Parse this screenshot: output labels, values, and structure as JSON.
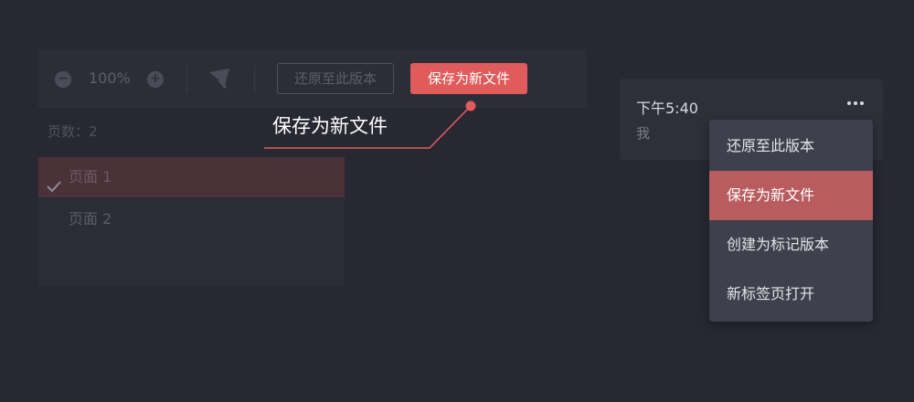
{
  "toolbar": {
    "zoom_out_icon": "minus-circle-icon",
    "zoom_level": "100%",
    "zoom_in_icon": "plus-circle-icon",
    "pointer_icon": "pointer-icon",
    "restore_label": "还原至此版本",
    "save_new_label": "保存为新文件"
  },
  "pages": {
    "count_label": "页数：2",
    "items": [
      {
        "label": "页面 1",
        "selected": true
      },
      {
        "label": "页面 2",
        "selected": false
      }
    ]
  },
  "callout": {
    "text": "保存为新文件",
    "color": "#e05b5b"
  },
  "history": {
    "time": "下午5:40",
    "user": "我",
    "more_icon": "more-dots-icon"
  },
  "menu": {
    "items": [
      {
        "label": "还原至此版本"
      },
      {
        "label": "保存为新文件",
        "active": true
      },
      {
        "label": "创建为标记版本"
      },
      {
        "label": "新标签页打开"
      }
    ]
  },
  "colors": {
    "accent": "#e05b5b",
    "menu_active": "#b95c60",
    "background": "#272832"
  }
}
